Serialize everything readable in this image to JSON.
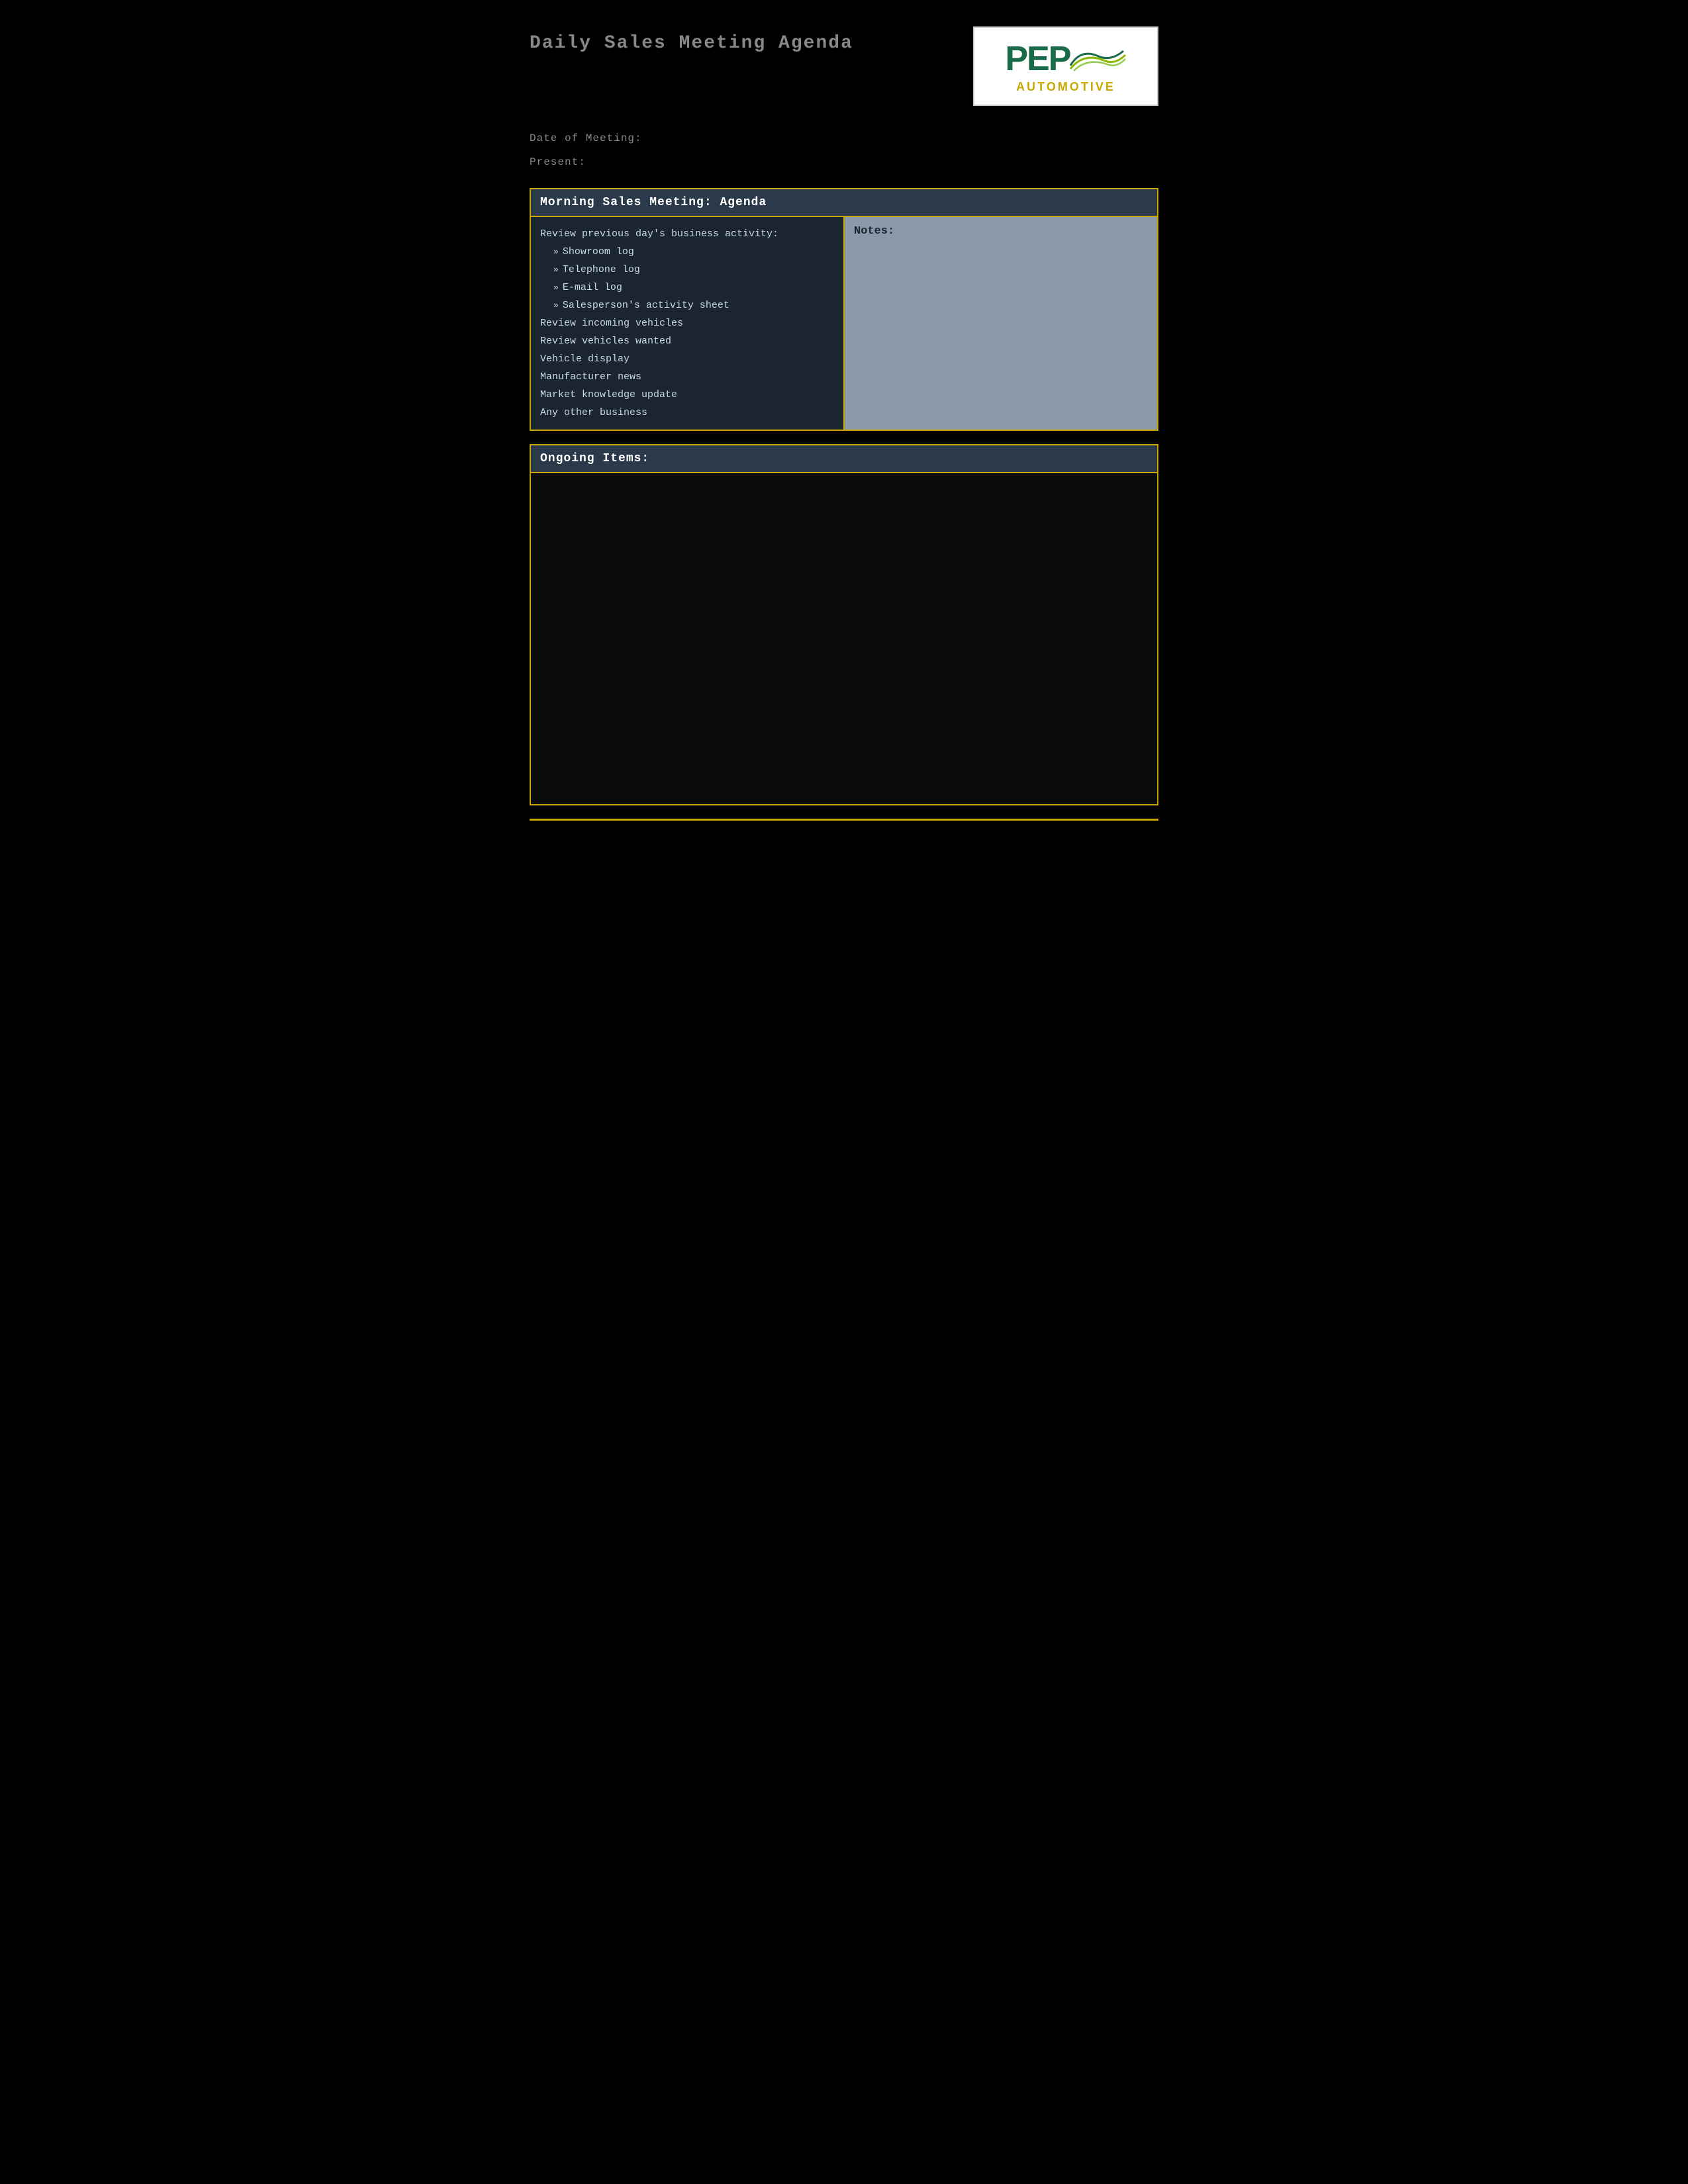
{
  "header": {
    "title": "Daily Sales Meeting Agenda",
    "logo": {
      "pep_text": "PEP",
      "automotive_text": "AUTOMOTIVE"
    }
  },
  "meta": {
    "date_label": "Date of Meeting:",
    "present_label": "Present:"
  },
  "morning_section": {
    "header": "Morning Sales Meeting: Agenda",
    "agenda_intro": "Review previous day's business activity:",
    "sub_items": [
      "Showroom log",
      "Telephone log",
      "E-mail log",
      "Salesperson's activity sheet"
    ],
    "main_items": [
      "Review incoming vehicles",
      "Review vehicles wanted",
      "Vehicle display",
      "Manufacturer news",
      "Market knowledge update",
      "Any other business"
    ],
    "notes_label": "Notes:"
  },
  "ongoing_section": {
    "header": "Ongoing Items:"
  }
}
